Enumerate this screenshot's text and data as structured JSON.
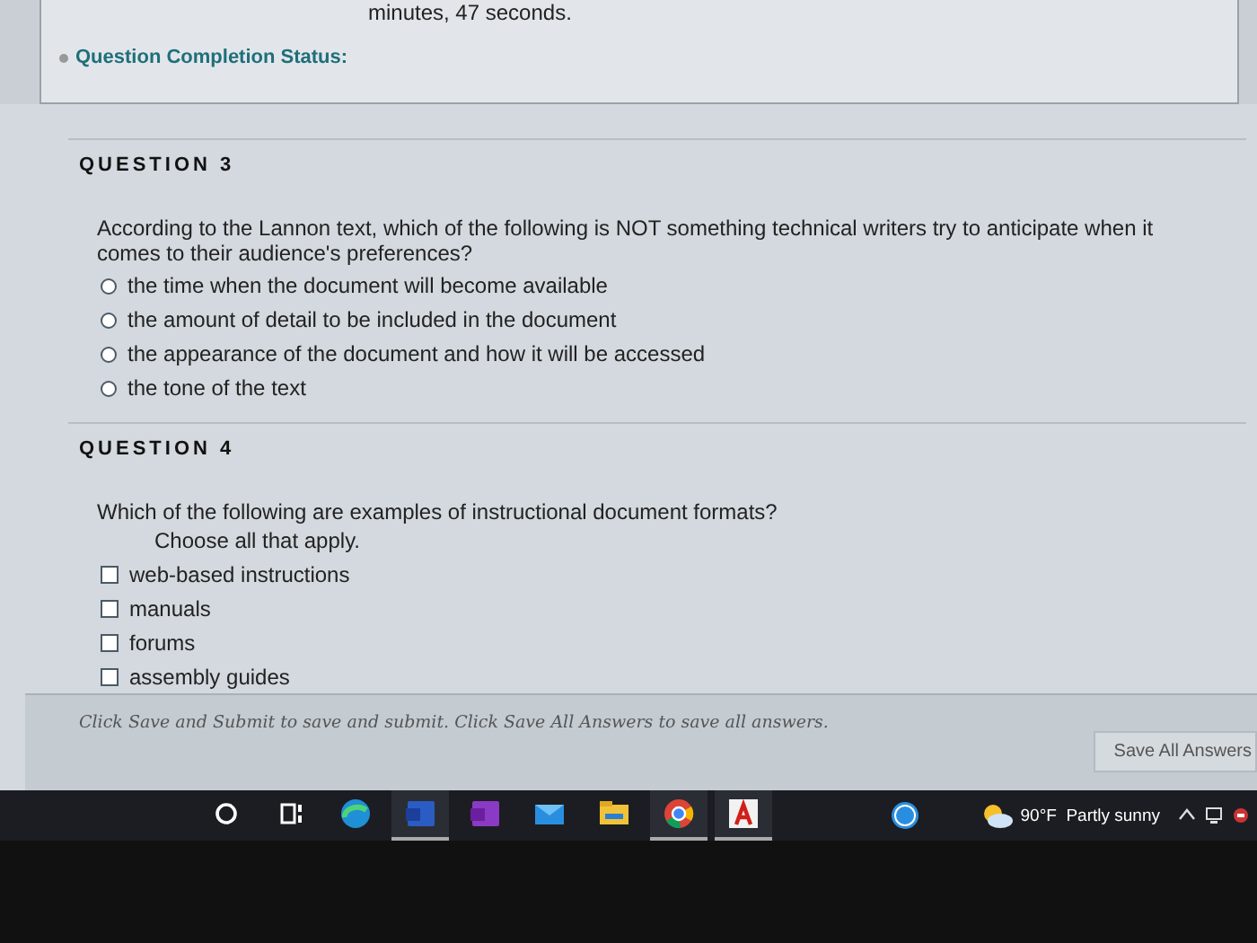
{
  "timer": {
    "text": "minutes, 47 seconds."
  },
  "completion_status": {
    "label": "Question Completion Status:"
  },
  "questions": [
    {
      "kind": "radio",
      "title": "QUESTION 3",
      "prompt": "According to the Lannon text, which of the following is NOT something technical writers try to anticipate when it comes to their audience's preferences?",
      "options": [
        {
          "label": "the time when the document will become available",
          "selected": false
        },
        {
          "label": "the amount of detail to be included in the document",
          "selected": false
        },
        {
          "label": "the appearance of the document and how it will be accessed",
          "selected": false
        },
        {
          "label": "the tone of the text",
          "selected": false
        }
      ]
    },
    {
      "kind": "checkbox",
      "title": "QUESTION 4",
      "prompt": "Which of the following are examples of instructional document formats?",
      "instruction": "Choose all that apply.",
      "options": [
        {
          "label": "web-based instructions",
          "checked": false
        },
        {
          "label": "manuals",
          "checked": false
        },
        {
          "label": "forums",
          "checked": false
        },
        {
          "label": "assembly guides",
          "checked": false
        }
      ]
    }
  ],
  "footer": {
    "note": "Click Save and Submit to save and submit. Click Save All Answers to save all answers.",
    "button": "Save All Answers"
  },
  "taskbar": {
    "apps": [
      {
        "kind": "search",
        "open": false
      },
      {
        "kind": "taskview",
        "open": false
      },
      {
        "kind": "edge",
        "open": false
      },
      {
        "kind": "word",
        "open": true
      },
      {
        "kind": "onenote",
        "open": false
      },
      {
        "kind": "mail",
        "open": false
      },
      {
        "kind": "explorer",
        "open": false
      },
      {
        "kind": "chrome",
        "open": true
      },
      {
        "kind": "acrobat",
        "open": true
      }
    ],
    "weather": "90°F  Partly sunny"
  }
}
